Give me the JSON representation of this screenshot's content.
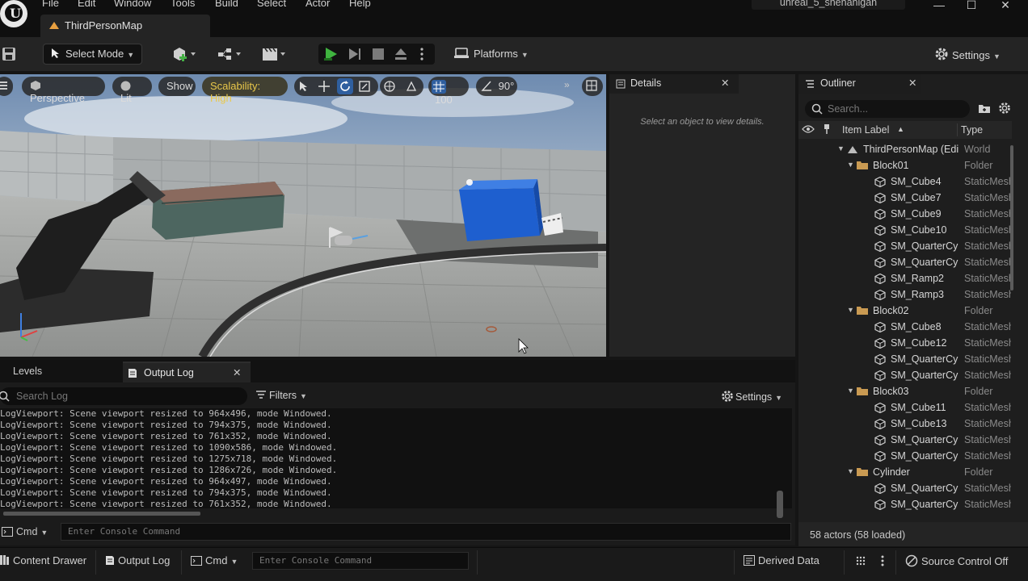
{
  "menu": [
    "File",
    "Edit",
    "Window",
    "Tools",
    "Build",
    "Select",
    "Actor",
    "Help"
  ],
  "project_name": "unreal_5_shenanigan",
  "map_tab": "ThirdPersonMap",
  "toolbar": {
    "select_mode": "Select Mode",
    "platforms": "Platforms",
    "settings": "Settings"
  },
  "viewport": {
    "perspective": "Perspective",
    "lit": "Lit",
    "show": "Show",
    "scalability": "Scalability: High",
    "grid_size": "100",
    "rotation_snap": "90°"
  },
  "details": {
    "tab": "Details",
    "empty_message": "Select an object to view details."
  },
  "outliner": {
    "tab": "Outliner",
    "search_placeholder": "Search...",
    "col_label": "Item Label",
    "col_type": "Type",
    "rows": [
      {
        "label": "ThirdPersonMap (Editor)",
        "type": "World",
        "depth": 0,
        "kind": "world"
      },
      {
        "label": "Block01",
        "type": "Folder",
        "depth": 1,
        "kind": "folder"
      },
      {
        "label": "SM_Cube4",
        "type": "StaticMeshActor",
        "depth": 2,
        "kind": "mesh"
      },
      {
        "label": "SM_Cube7",
        "type": "StaticMeshActor",
        "depth": 2,
        "kind": "mesh"
      },
      {
        "label": "SM_Cube9",
        "type": "StaticMeshActor",
        "depth": 2,
        "kind": "mesh"
      },
      {
        "label": "SM_Cube10",
        "type": "StaticMeshActor",
        "depth": 2,
        "kind": "mesh"
      },
      {
        "label": "SM_QuarterCylinder",
        "type": "StaticMeshActor",
        "depth": 2,
        "kind": "mesh"
      },
      {
        "label": "SM_QuarterCylinder",
        "type": "StaticMeshActor",
        "depth": 2,
        "kind": "mesh"
      },
      {
        "label": "SM_Ramp2",
        "type": "StaticMeshActor",
        "depth": 2,
        "kind": "mesh"
      },
      {
        "label": "SM_Ramp3",
        "type": "StaticMeshActor",
        "depth": 2,
        "kind": "mesh"
      },
      {
        "label": "Block02",
        "type": "Folder",
        "depth": 1,
        "kind": "folder"
      },
      {
        "label": "SM_Cube8",
        "type": "StaticMeshActor",
        "depth": 2,
        "kind": "mesh"
      },
      {
        "label": "SM_Cube12",
        "type": "StaticMeshActor",
        "depth": 2,
        "kind": "mesh"
      },
      {
        "label": "SM_QuarterCylinder",
        "type": "StaticMeshActor",
        "depth": 2,
        "kind": "mesh"
      },
      {
        "label": "SM_QuarterCylinder",
        "type": "StaticMeshActor",
        "depth": 2,
        "kind": "mesh"
      },
      {
        "label": "Block03",
        "type": "Folder",
        "depth": 1,
        "kind": "folder"
      },
      {
        "label": "SM_Cube11",
        "type": "StaticMeshActor",
        "depth": 2,
        "kind": "mesh"
      },
      {
        "label": "SM_Cube13",
        "type": "StaticMeshActor",
        "depth": 2,
        "kind": "mesh"
      },
      {
        "label": "SM_QuarterCylinder",
        "type": "StaticMeshActor",
        "depth": 2,
        "kind": "mesh"
      },
      {
        "label": "SM_QuarterCylinder",
        "type": "StaticMeshActor",
        "depth": 2,
        "kind": "mesh"
      },
      {
        "label": "Cylinder",
        "type": "Folder",
        "depth": 1,
        "kind": "folder"
      },
      {
        "label": "SM_QuarterCylinder",
        "type": "StaticMeshActor",
        "depth": 2,
        "kind": "mesh"
      },
      {
        "label": "SM_QuarterCylinder",
        "type": "StaticMeshActor",
        "depth": 2,
        "kind": "mesh"
      }
    ],
    "actor_count": "58 actors (58 loaded)"
  },
  "log": {
    "tab_levels": "Levels",
    "tab_output": "Output Log",
    "search_placeholder": "Search Log",
    "filters": "Filters",
    "settings": "Settings",
    "lines": [
      "LogViewport: Scene viewport resized to 964x496, mode Windowed.",
      "LogViewport: Scene viewport resized to 794x375, mode Windowed.",
      "LogViewport: Scene viewport resized to 761x352, mode Windowed.",
      "LogViewport: Scene viewport resized to 1090x586, mode Windowed.",
      "LogViewport: Scene viewport resized to 1275x718, mode Windowed.",
      "LogViewport: Scene viewport resized to 1286x726, mode Windowed.",
      "LogViewport: Scene viewport resized to 964x497, mode Windowed.",
      "LogViewport: Scene viewport resized to 794x375, mode Windowed.",
      "LogViewport: Scene viewport resized to 761x352, mode Windowed."
    ],
    "cmd_label": "Cmd",
    "cmd_placeholder": "Enter Console Command"
  },
  "statusbar": {
    "content_drawer": "Content Drawer",
    "output_log": "Output Log",
    "cmd_label": "Cmd",
    "cmd_placeholder": "Enter Console Command",
    "derived_data": "Derived Data",
    "source_control": "Source Control Off"
  }
}
